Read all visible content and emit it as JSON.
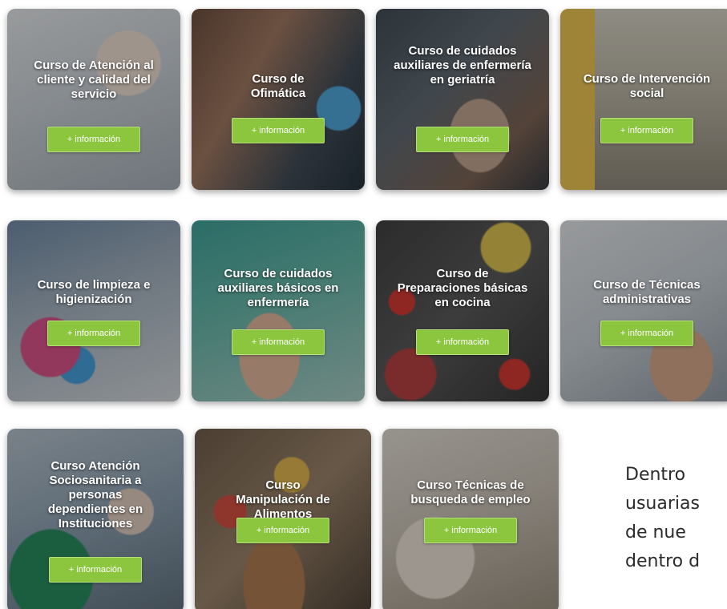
{
  "courses": [
    {
      "title": "Curso de Atención al cliente y calidad del servicio",
      "button": "+ información"
    },
    {
      "title": "Curso de Ofimática",
      "button": "+ información"
    },
    {
      "title": "Curso de cuidados auxiliares de enfermería en geriatría",
      "button": "+ información"
    },
    {
      "title": "Curso de Intervención social",
      "button": "+ información"
    },
    {
      "title": "Curso de limpieza e higienización",
      "button": "+ información"
    },
    {
      "title": "Curso de cuidados auxiliares básicos en enfermería",
      "button": "+ información"
    },
    {
      "title": "Curso de Preparaciones básicas en cocina",
      "button": "+ información"
    },
    {
      "title": "Curso de Técnicas administrativas",
      "button": "+ información"
    },
    {
      "title": "Curso Atención Sociosanitaria a personas dependientes en Instituciones",
      "button": "+ información"
    },
    {
      "title": "Curso Manipulación de Alimentos",
      "button": "+ información"
    },
    {
      "title": "Curso Técnicas de busqueda de empleo",
      "button": "+ información"
    }
  ],
  "intro_text": {
    "line1": "Dentro",
    "line2": "usuarias",
    "line3": "de   nue",
    "line4": "dentro d"
  },
  "colors": {
    "button_green": "#8cc63f",
    "text_dark": "#2b2b2b"
  }
}
